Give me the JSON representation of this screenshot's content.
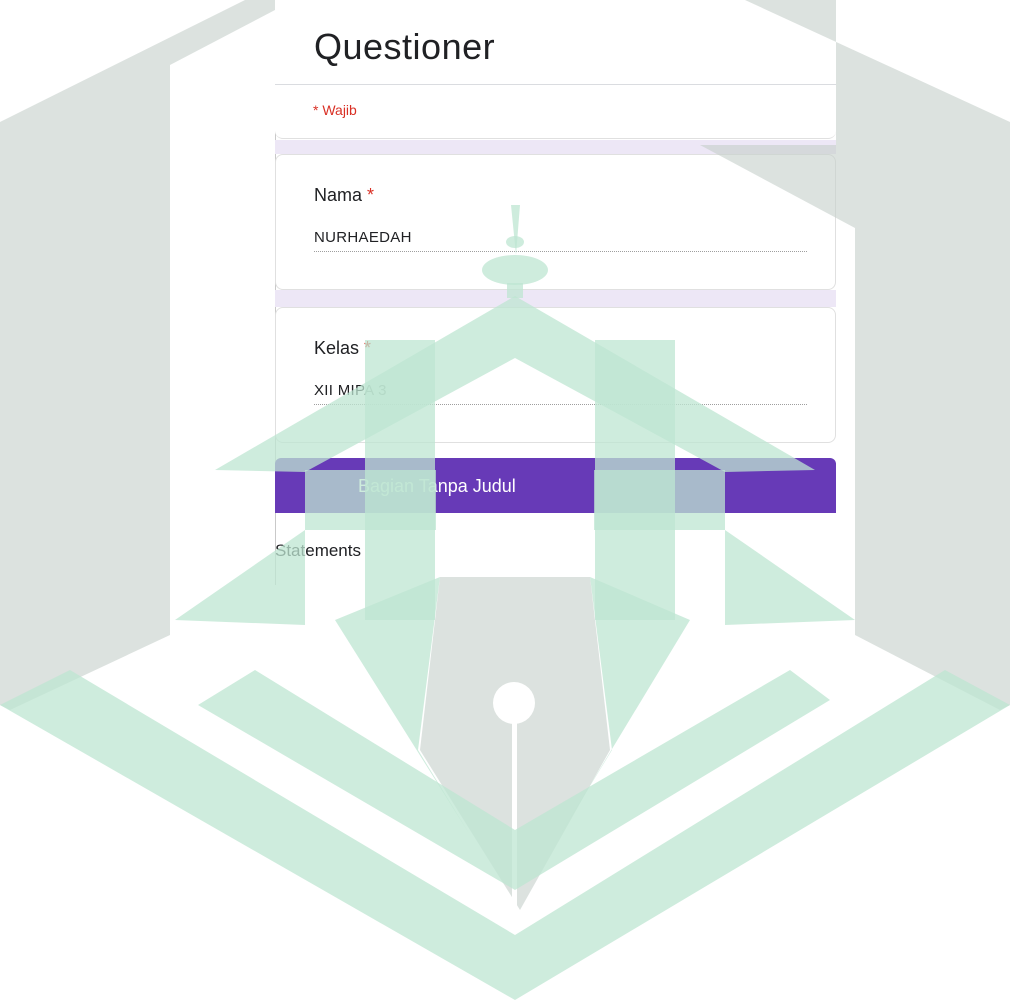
{
  "form": {
    "title": "Questioner",
    "required_note": "* Wajib",
    "questions": [
      {
        "label": "Nama",
        "required_mark": "*",
        "answer": "NURHAEDAH"
      },
      {
        "label": "Kelas",
        "required_mark": "*",
        "answer": "XII MIPA 3"
      }
    ],
    "section_title": "Bagian Tanpa Judul",
    "section_description": "Statements"
  },
  "colors": {
    "accent": "#673ab7",
    "required": "#d93025",
    "section_gap": "#ede7f6",
    "watermark_gray": "#c5cfca",
    "watermark_green": "#bde6d1"
  },
  "watermark": {
    "icon": "fountain-pen-mosque-logo-icon"
  }
}
